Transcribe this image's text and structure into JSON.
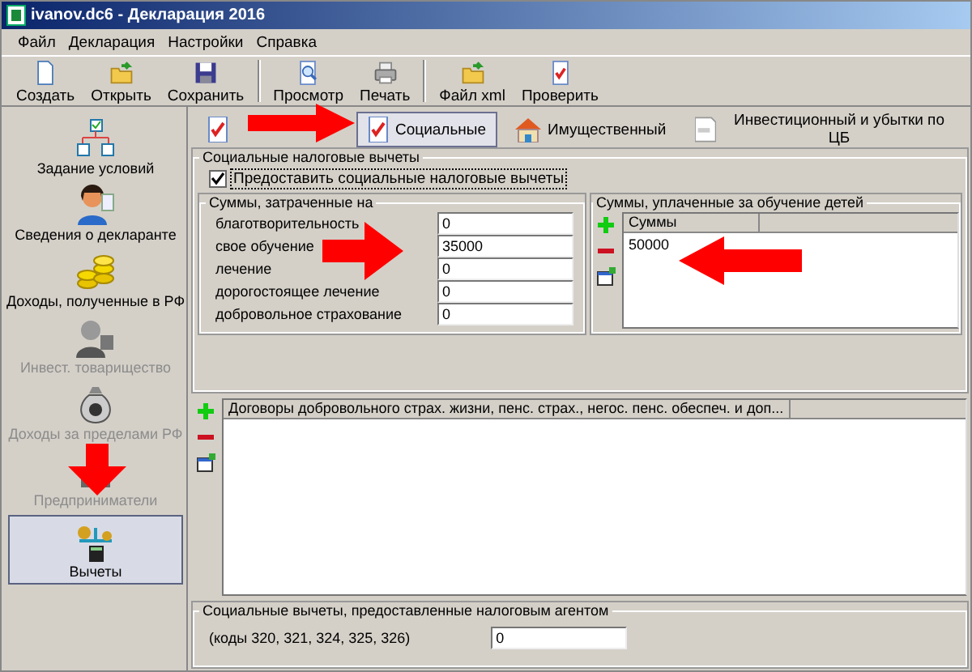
{
  "window": {
    "title": "ivanov.dc6 - Декларация 2016"
  },
  "menu": [
    "Файл",
    "Декларация",
    "Настройки",
    "Справка"
  ],
  "toolbar": [
    {
      "label": "Создать",
      "kind": "new"
    },
    {
      "label": "Открыть",
      "kind": "open"
    },
    {
      "label": "Сохранить",
      "kind": "save"
    },
    {
      "label": "Просмотр",
      "kind": "preview"
    },
    {
      "label": "Печать",
      "kind": "print"
    },
    {
      "label": "Файл xml",
      "kind": "xml"
    },
    {
      "label": "Проверить",
      "kind": "check"
    }
  ],
  "sidebar": [
    {
      "label": "Задание условий",
      "kind": "conditions",
      "disabled": false,
      "selected": false
    },
    {
      "label": "Сведения о декларанте",
      "kind": "person",
      "disabled": false,
      "selected": false
    },
    {
      "label": "Доходы, полученные в РФ",
      "kind": "coins",
      "disabled": false,
      "selected": false
    },
    {
      "label": "Инвест. товарищество",
      "kind": "investor",
      "disabled": true,
      "selected": false
    },
    {
      "label": "Доходы за пределами РФ",
      "kind": "moneybag",
      "disabled": true,
      "selected": false
    },
    {
      "label": "Предприниматели",
      "kind": "entrepreneur",
      "disabled": true,
      "selected": false
    },
    {
      "label": "Вычеты",
      "kind": "deductions",
      "disabled": false,
      "selected": true
    }
  ],
  "tabs": [
    {
      "kind": "standard",
      "selected": false
    },
    {
      "label": "Социальные",
      "kind": "social",
      "selected": true
    },
    {
      "label": "Имущественный",
      "kind": "property",
      "selected": false
    },
    {
      "label": "Инвестиционный и убытки по ЦБ",
      "kind": "securities",
      "selected": false
    }
  ],
  "social": {
    "title": "Социальные налоговые вычеты",
    "provide": {
      "label": "Предоставить социальные налоговые вычеты",
      "checked": true
    },
    "spent": {
      "title": "Суммы, затраченные на",
      "fields": [
        {
          "label": "благотворительность",
          "value": "0"
        },
        {
          "label": "свое обучение",
          "value": "35000"
        },
        {
          "label": "лечение",
          "value": "0"
        },
        {
          "label": "дорогостоящее лечение",
          "value": "0"
        },
        {
          "label": "добровольное страхование",
          "value": "0"
        }
      ]
    },
    "children": {
      "title": "Суммы, уплаченные за обучение детей",
      "column": "Суммы",
      "rows": [
        "50000"
      ]
    }
  },
  "contracts": {
    "column": "Договоры добровольного страх. жизни, пенс. страх., негос. пенс. обеспеч. и доп..."
  },
  "agent": {
    "title": "Социальные вычеты, предоставленные налоговым агентом",
    "label": "(коды 320, 321, 324, 325, 326)",
    "value": "0"
  }
}
